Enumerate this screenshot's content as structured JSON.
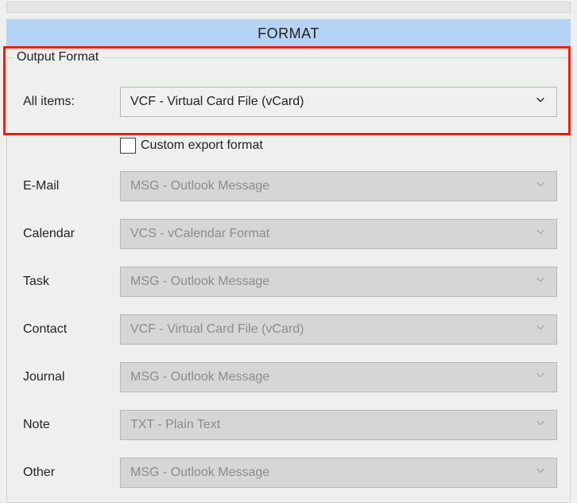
{
  "header": {
    "title": "FORMAT"
  },
  "group": {
    "legend": "Output Format"
  },
  "allItems": {
    "label": "All items:",
    "value": "VCF - Virtual Card File (vCard)"
  },
  "checkbox": {
    "label": "Custom export format",
    "checked": false
  },
  "rows": {
    "email": {
      "label": "E-Mail",
      "value": "MSG - Outlook Message"
    },
    "calendar": {
      "label": "Calendar",
      "value": "VCS - vCalendar Format"
    },
    "task": {
      "label": "Task",
      "value": "MSG - Outlook Message"
    },
    "contact": {
      "label": "Contact",
      "value": "VCF - Virtual Card File (vCard)"
    },
    "journal": {
      "label": "Journal",
      "value": "MSG - Outlook Message"
    },
    "note": {
      "label": "Note",
      "value": "TXT - Plain Text"
    },
    "other": {
      "label": "Other",
      "value": "MSG - Outlook Message"
    }
  }
}
